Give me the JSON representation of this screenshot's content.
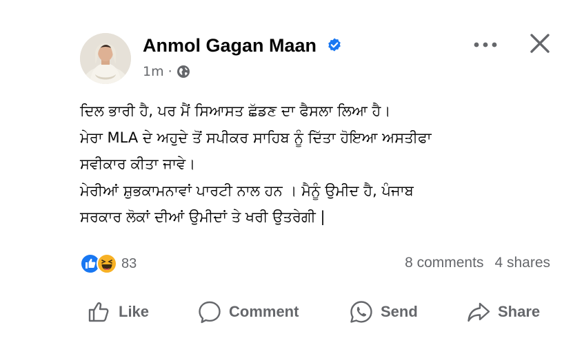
{
  "post": {
    "author_name": "Anmol Gagan Maan",
    "verified_icon": "verified-badge-icon",
    "timestamp": "1m",
    "separator": "·",
    "audience_icon": "globe-icon",
    "lines": [
      "ਦਿਲ ਭਾਰੀ ਹੈ, ਪਰ ਮੈਂ ਸਿਆਸਤ ਛੱਡਣ ਦਾ ਫੈਸਲਾ ਲਿਆ ਹੈ।",
      "ਮੇਰਾ MLA ਦੇ ਅਹੁਦੇ ਤੋਂ ਸਪੀਕਰ ਸਾਹਿਬ ਨੂੰ ਦਿੱਤਾ ਹੋਇਆ ਅਸਤੀਫਾ",
      "ਸਵੀਕਾਰ ਕੀਤਾ ਜਾਵੇ।",
      "ਮੇਰੀਆਂ ਸ਼ੁਭਕਾਮਨਾਵਾਂ ਪਾਰਟੀ ਨਾਲ ਹਨ । ਮੈਨੂੰ ਉਮੀਦ ਹੈ,  ਪੰਜਾਬ",
      "ਸਰਕਾਰ ਲੋਕਾਂ ਦੀਆਂ ਉਮੀਦਾਂ ਤੇ ਖਰੀ ਉਤਰੇਗੀ |"
    ]
  },
  "reactions": {
    "icons": [
      "like-reaction-icon",
      "haha-reaction-icon"
    ],
    "count": "83",
    "comments": "8 comments",
    "shares": "4 shares"
  },
  "actions": {
    "like": "Like",
    "comment": "Comment",
    "send": "Send",
    "share": "Share"
  },
  "colors": {
    "text": "#050505",
    "secondary": "#65676b",
    "brand_blue": "#1877f2",
    "haha_yellow": "#f7b125"
  }
}
